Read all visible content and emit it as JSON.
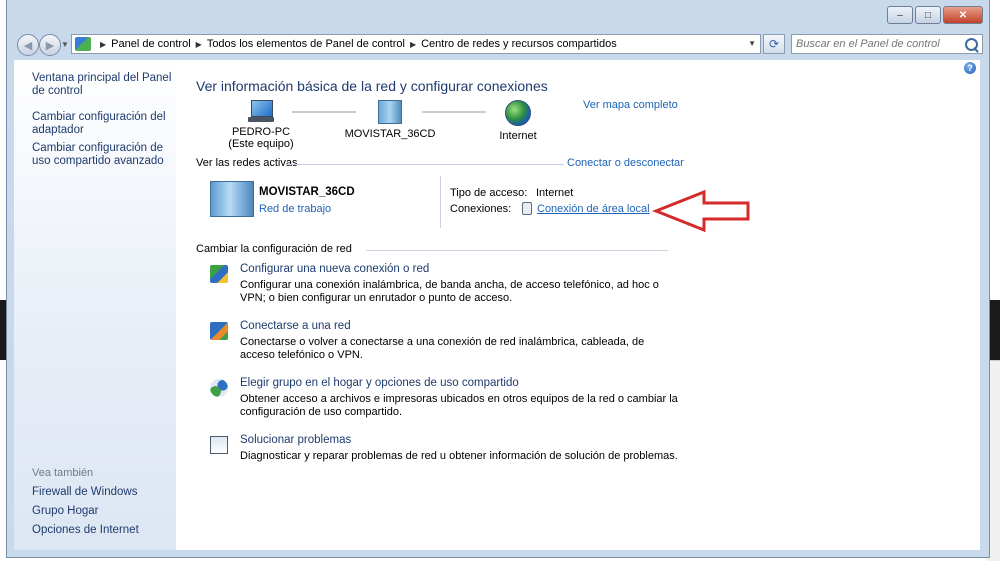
{
  "window": {
    "caption": {
      "minimize": "–",
      "maximize": "□",
      "close": "✕"
    }
  },
  "navbar": {
    "breadcrumbs": [
      "Panel de control",
      "Todos los elementos de Panel de control",
      "Centro de redes y recursos compartidos"
    ],
    "search_placeholder": "Buscar en el Panel de control"
  },
  "sidebar": {
    "links": [
      "Ventana principal del Panel de control",
      "Cambiar configuración del adaptador",
      "Cambiar configuración de uso compartido avanzado"
    ],
    "see_also_label": "Vea también",
    "see_also": [
      "Firewall de Windows",
      "Grupo Hogar",
      "Opciones de Internet"
    ]
  },
  "main": {
    "title": "Ver información básica de la red y configurar conexiones",
    "map_link": "Ver mapa completo",
    "map": {
      "pc_name": "PEDRO-PC",
      "pc_sub": "(Este equipo)",
      "network": "MOVISTAR_36CD",
      "internet": "Internet"
    },
    "active_networks_label": "Ver las redes activas",
    "connect_link": "Conectar o desconectar",
    "active": {
      "name": "MOVISTAR_36CD",
      "type": "Red de trabajo",
      "access_label": "Tipo de acceso:",
      "access_value": "Internet",
      "connections_label": "Conexiones:",
      "connection_link": "Conexión de área local"
    },
    "change_label": "Cambiar la configuración de red",
    "tasks": [
      {
        "icon": "network-wizard-icon",
        "title": "Configurar una nueva conexión o red",
        "desc": "Configurar una conexión inalámbrica, de banda ancha, de acceso telefónico, ad hoc o VPN; o bien configurar un enrutador o punto de acceso."
      },
      {
        "icon": "connect-network-icon",
        "title": "Conectarse a una red",
        "desc": "Conectarse o volver a conectarse a una conexión de red inalámbrica, cableada, de acceso telefónico o VPN."
      },
      {
        "icon": "homegroup-icon",
        "title": "Elegir grupo en el hogar y opciones de uso compartido",
        "desc": "Obtener acceso a archivos e impresoras ubicados en otros equipos de la red o cambiar la configuración de uso compartido."
      },
      {
        "icon": "troubleshoot-icon",
        "title": "Solucionar problemas",
        "desc": "Diagnosticar y reparar problemas de red u obtener información de solución de problemas."
      }
    ]
  },
  "colors": {
    "link": "#1e63b8",
    "heading": "#1e3b6e",
    "arrow": "#d42a2a",
    "frame": "#c9d9ec"
  }
}
